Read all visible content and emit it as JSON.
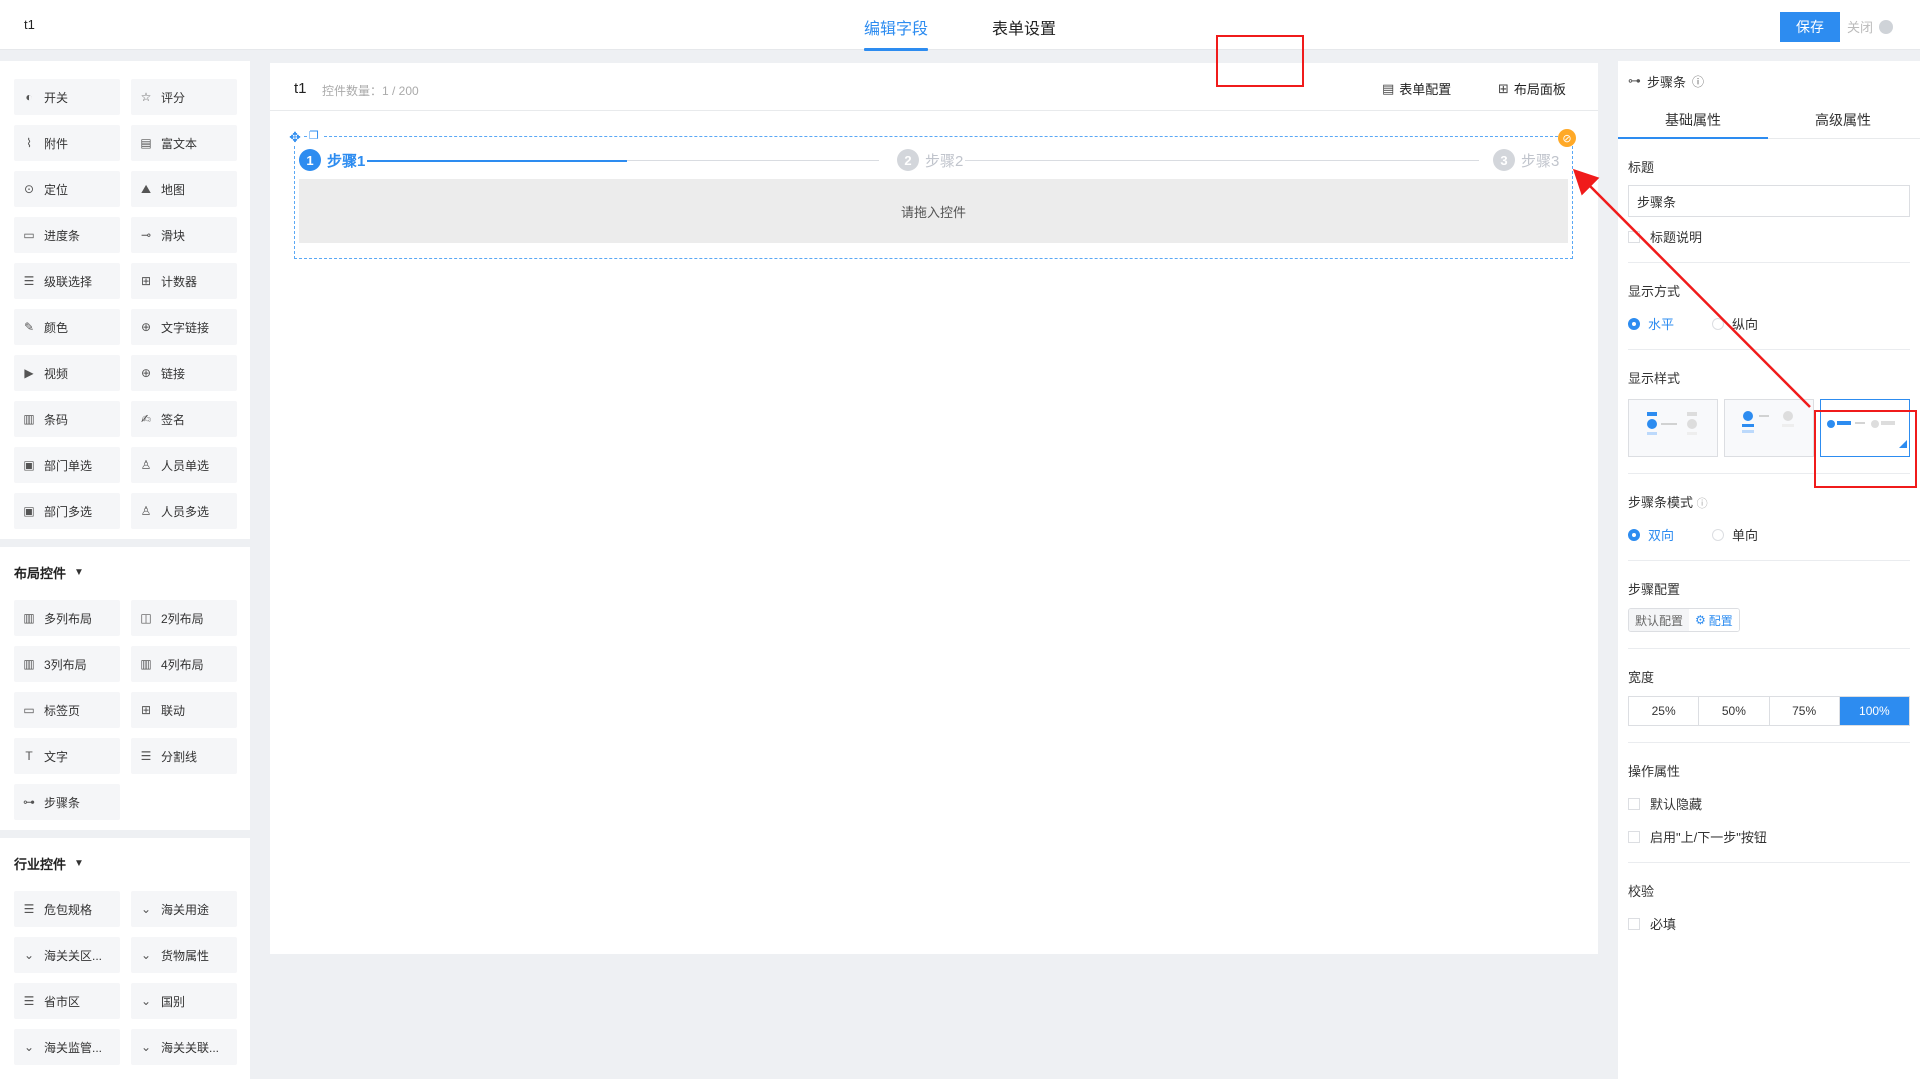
{
  "topbar": {
    "app_title": "t1",
    "tabs": [
      "编辑字段",
      "表单设置"
    ],
    "save_label": "保存",
    "close_label": "关闭"
  },
  "components": [
    {
      "icon": "toggle-icon",
      "glyph": "◐",
      "label": "开关"
    },
    {
      "icon": "star-icon",
      "glyph": "☆",
      "label": "评分"
    },
    {
      "icon": "paperclip-icon",
      "glyph": "⌇",
      "label": "附件"
    },
    {
      "icon": "richtext-icon",
      "glyph": "▤",
      "label": "富文本"
    },
    {
      "icon": "location-icon",
      "glyph": "⊙",
      "label": "定位"
    },
    {
      "icon": "map-icon",
      "glyph": "⛰",
      "label": "地图"
    },
    {
      "icon": "progress-icon",
      "glyph": "▭",
      "label": "进度条"
    },
    {
      "icon": "slider-icon",
      "glyph": "⊸",
      "label": "滑块"
    },
    {
      "icon": "cascade-icon",
      "glyph": "☰",
      "label": "级联选择"
    },
    {
      "icon": "counter-icon",
      "glyph": "⊞",
      "label": "计数器"
    },
    {
      "icon": "color-picker-icon",
      "glyph": "✎",
      "label": "颜色"
    },
    {
      "icon": "globe-icon",
      "glyph": "⊕",
      "label": "文字链接"
    },
    {
      "icon": "video-icon",
      "glyph": "▶",
      "label": "视频"
    },
    {
      "icon": "link-globe-icon",
      "glyph": "⊕",
      "label": "链接"
    },
    {
      "icon": "barcode-icon",
      "glyph": "▥",
      "label": "条码"
    },
    {
      "icon": "signature-icon",
      "glyph": "✍",
      "label": "签名"
    },
    {
      "icon": "department-icon",
      "glyph": "▣",
      "label": "部门单选"
    },
    {
      "icon": "user-icon",
      "glyph": "♙",
      "label": "人员单选"
    },
    {
      "icon": "departments-icon",
      "glyph": "▣",
      "label": "部门多选"
    },
    {
      "icon": "users-icon",
      "glyph": "♙",
      "label": "人员多选"
    }
  ],
  "layout_group": {
    "title": "布局控件",
    "items": [
      {
        "icon": "multi-column-icon",
        "glyph": "▥",
        "label": "多列布局"
      },
      {
        "icon": "two-column-icon",
        "glyph": "◫",
        "label": "2列布局"
      },
      {
        "icon": "three-column-icon",
        "glyph": "▥",
        "label": "3列布局"
      },
      {
        "icon": "four-column-icon",
        "glyph": "▥",
        "label": "4列布局"
      },
      {
        "icon": "tab-page-icon",
        "glyph": "▭",
        "label": "标签页"
      },
      {
        "icon": "linkage-icon",
        "glyph": "⊞",
        "label": "联动"
      },
      {
        "icon": "text-icon",
        "glyph": "T",
        "label": "文字"
      },
      {
        "icon": "divider-icon",
        "glyph": "☰",
        "label": "分割线"
      },
      {
        "icon": "steps-icon",
        "glyph": "⊶",
        "label": "步骤条"
      }
    ]
  },
  "industry_group": {
    "title": "行业控件",
    "items": [
      {
        "icon": "package-spec-icon",
        "glyph": "☰",
        "label": "危包规格"
      },
      {
        "icon": "chevron-down-icon",
        "glyph": "⌄",
        "label": "海关用途"
      },
      {
        "icon": "chevron-down-icon",
        "glyph": "⌄",
        "label": "海关关区..."
      },
      {
        "icon": "chevron-down-icon",
        "glyph": "⌄",
        "label": "货物属性"
      },
      {
        "icon": "region-icon",
        "glyph": "☰",
        "label": "省市区"
      },
      {
        "icon": "chevron-down-icon",
        "glyph": "⌄",
        "label": "国别"
      },
      {
        "icon": "chevron-down-icon",
        "glyph": "⌄",
        "label": "海关监管..."
      },
      {
        "icon": "chevron-down-icon",
        "glyph": "⌄",
        "label": "海关关联..."
      }
    ]
  },
  "canvas": {
    "form_name": "t1",
    "count_text": "控件数量：1 / 200",
    "form_config_label": "表单配置",
    "layout_panel_label": "布局面板",
    "steps": [
      {
        "num": "1",
        "label": "步骤1"
      },
      {
        "num": "2",
        "label": "步骤2"
      },
      {
        "num": "3",
        "label": "步骤3"
      }
    ],
    "drop_hint": "请拖入控件"
  },
  "props": {
    "header_label": "步骤条",
    "tabs": [
      "基础属性",
      "高级属性"
    ],
    "title_section": "标题",
    "title_value": "步骤条",
    "title_desc_label": "标题说明",
    "display_mode_section": "显示方式",
    "display_modes": [
      "水平",
      "纵向"
    ],
    "display_style_section": "显示样式",
    "step_mode_section": "步骤条模式",
    "step_modes": [
      "双向",
      "单向"
    ],
    "step_config_section": "步骤配置",
    "step_config_options": [
      "默认配置",
      "配置"
    ],
    "width_section": "宽度",
    "widths": [
      "25%",
      "50%",
      "75%",
      "100%"
    ],
    "ops_section": "操作属性",
    "default_hidden_label": "默认隐藏",
    "enable_nav_label": "启用\"上/下一步\"按钮",
    "validation_section": "校验",
    "required_label": "必填"
  },
  "colors": {
    "accent": "#2d8cf0",
    "highlight": "#f01b1b",
    "delete_badge": "#ffa927"
  }
}
